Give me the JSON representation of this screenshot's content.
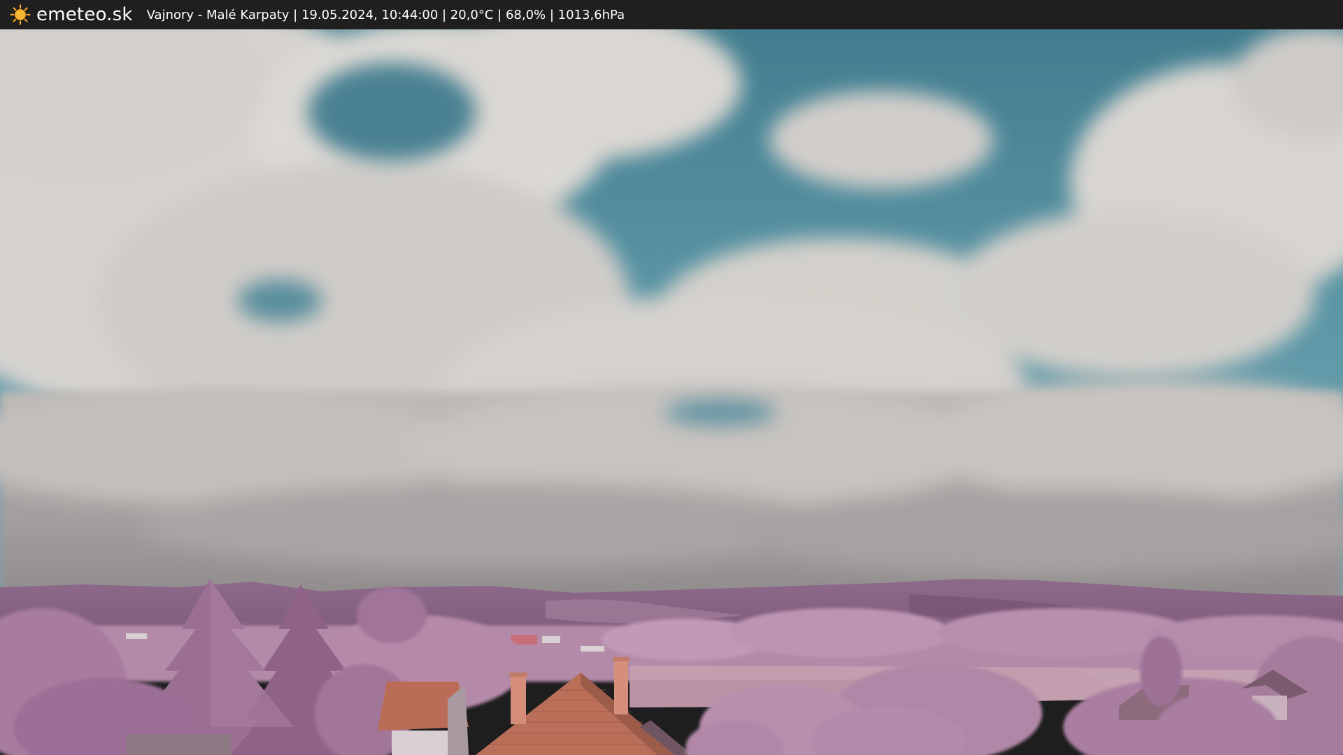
{
  "header": {
    "logo_icon": "sun-icon",
    "brand": "emeteo.sk",
    "status_line": "Vajnory - Malé Karpaty | 19.05.2024, 10:44:00 | 20,0°C | 68,0% | 1013,6hPa"
  },
  "scene": {
    "subject": "infrared-webcam-landscape",
    "colors": {
      "sky_top": "#3d7a8c",
      "sky_mid": "#5d98a8",
      "cloud": "#d9d6d1",
      "cloud_shadow": "#9e9a98",
      "hills": "#8a6585",
      "foliage": "#b58aaa",
      "foliage_dark": "#8d6487",
      "roof": "#b86a52",
      "chimney": "#d98f7c"
    }
  }
}
